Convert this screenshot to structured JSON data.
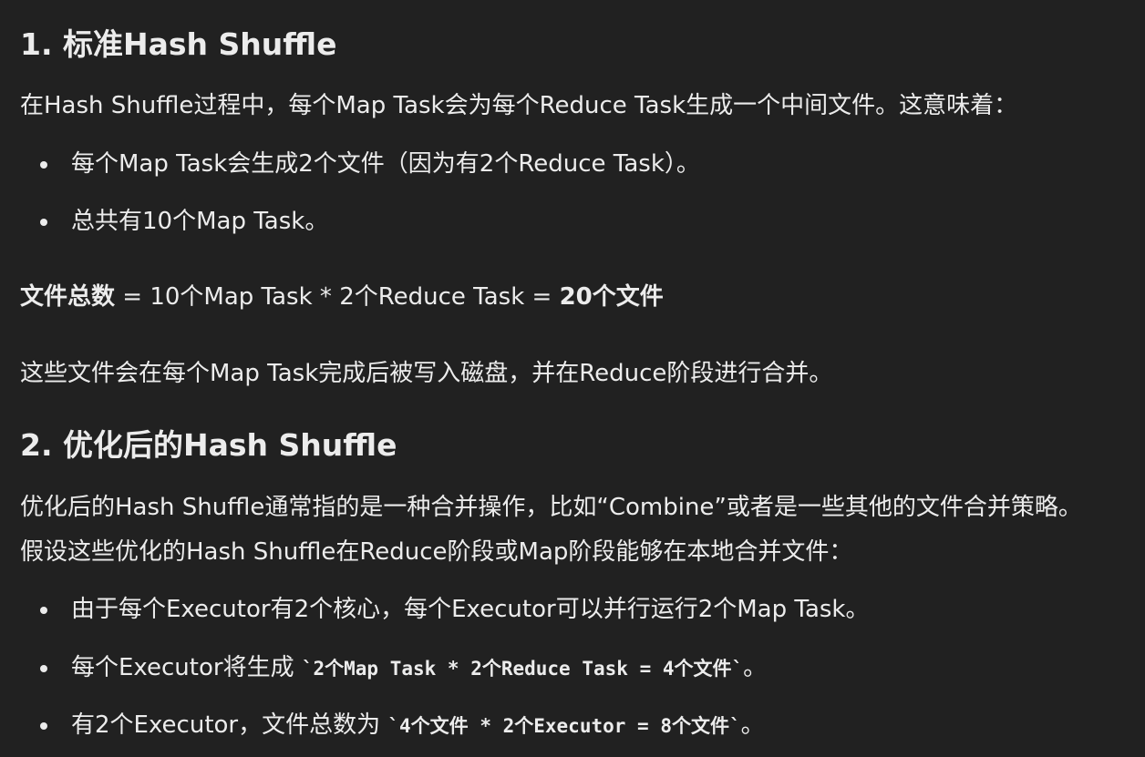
{
  "section1": {
    "heading": "1. 标准Hash Shuffle",
    "intro": "在Hash Shuffle过程中，每个Map Task会为每个Reduce Task生成一个中间文件。这意味着：",
    "bullets": [
      "每个Map Task会生成2个文件（因为有2个Reduce Task）。",
      "总共有10个Map Task。"
    ],
    "total_label": "文件总数",
    "total_expr": " = 10个Map Task * 2个Reduce Task = ",
    "total_result": "20个文件",
    "closing": "这些文件会在每个Map Task完成后被写入磁盘，并在Reduce阶段进行合并。"
  },
  "section2": {
    "heading": "2. 优化后的Hash Shuffle",
    "intro_line1": "优化后的Hash Shuffle通常指的是一种合并操作，比如“Combine”或者是一些其他的文件合并策略。",
    "intro_line2": "假设这些优化的Hash Shuffle在Reduce阶段或Map阶段能够在本地合并文件：",
    "bullet1": "由于每个Executor有2个核心，每个Executor可以并行运行2个Map Task。",
    "bullet2_prefix": "每个Executor将生成 ",
    "bullet2_code": "`2个Map Task * 2个Reduce Task = 4个文件`",
    "bullet2_suffix": "。",
    "bullet3_prefix": "有2个Executor，文件总数为 ",
    "bullet3_code": "`4个文件 * 2个Executor = 8个文件`",
    "bullet3_suffix": "。"
  }
}
